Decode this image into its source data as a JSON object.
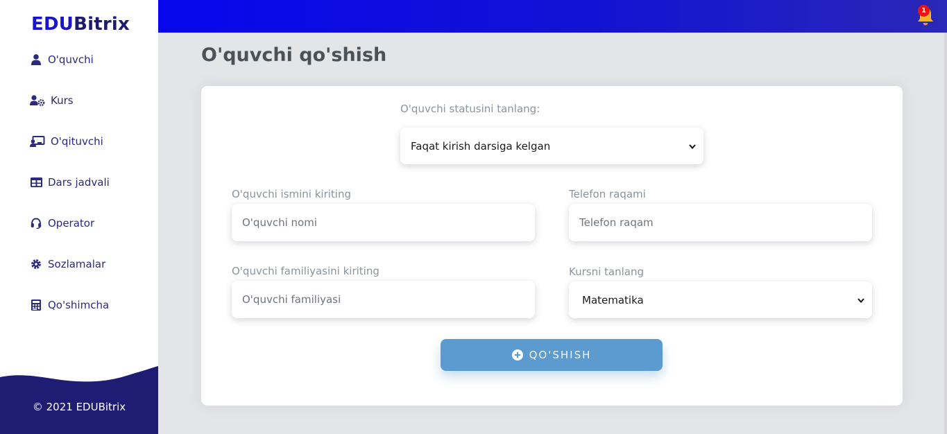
{
  "brand": {
    "part1": "EDU",
    "part2": "Bitrix"
  },
  "sidebar": {
    "items": [
      {
        "label": "O'quvchi",
        "icon": "user-icon"
      },
      {
        "label": "Kurs",
        "icon": "user-gear-icon"
      },
      {
        "label": "O'qituvchi",
        "icon": "chalkboard-teacher-icon"
      },
      {
        "label": "Dars jadvali",
        "icon": "table-icon"
      },
      {
        "label": "Operator",
        "icon": "headset-icon"
      },
      {
        "label": "Sozlamalar",
        "icon": "gear-icon"
      },
      {
        "label": "Qo'shimcha",
        "icon": "calculator-icon"
      }
    ],
    "footer": "© 2021 EDUBitrix"
  },
  "topbar": {
    "notification_count": "1",
    "icon": "bell-icon"
  },
  "page": {
    "title": "O'quvchi qo'shish"
  },
  "form": {
    "status": {
      "label": "O'quvchi statusini tanlang:",
      "value": "Faqat kirish darsiga kelgan"
    },
    "name": {
      "label": "O'quvchi ismini kiriting",
      "placeholder": "O'quvchi nomi"
    },
    "phone": {
      "label": "Telefon raqami",
      "placeholder": "Telefon raqam"
    },
    "surname": {
      "label": "O'quvchi familiyasini kiriting",
      "placeholder": "O'quvchi familiyasi"
    },
    "course": {
      "label": "Kursni tanlang",
      "value": "Matematika"
    },
    "submit_label": "QO'SHISH"
  },
  "colors": {
    "brand_blue": "#1a14c9",
    "sidebar_dark": "#1f1d73",
    "topbar_blue": "#0707ee",
    "button_blue": "#5b9bcf",
    "badge_red": "#f01111"
  }
}
